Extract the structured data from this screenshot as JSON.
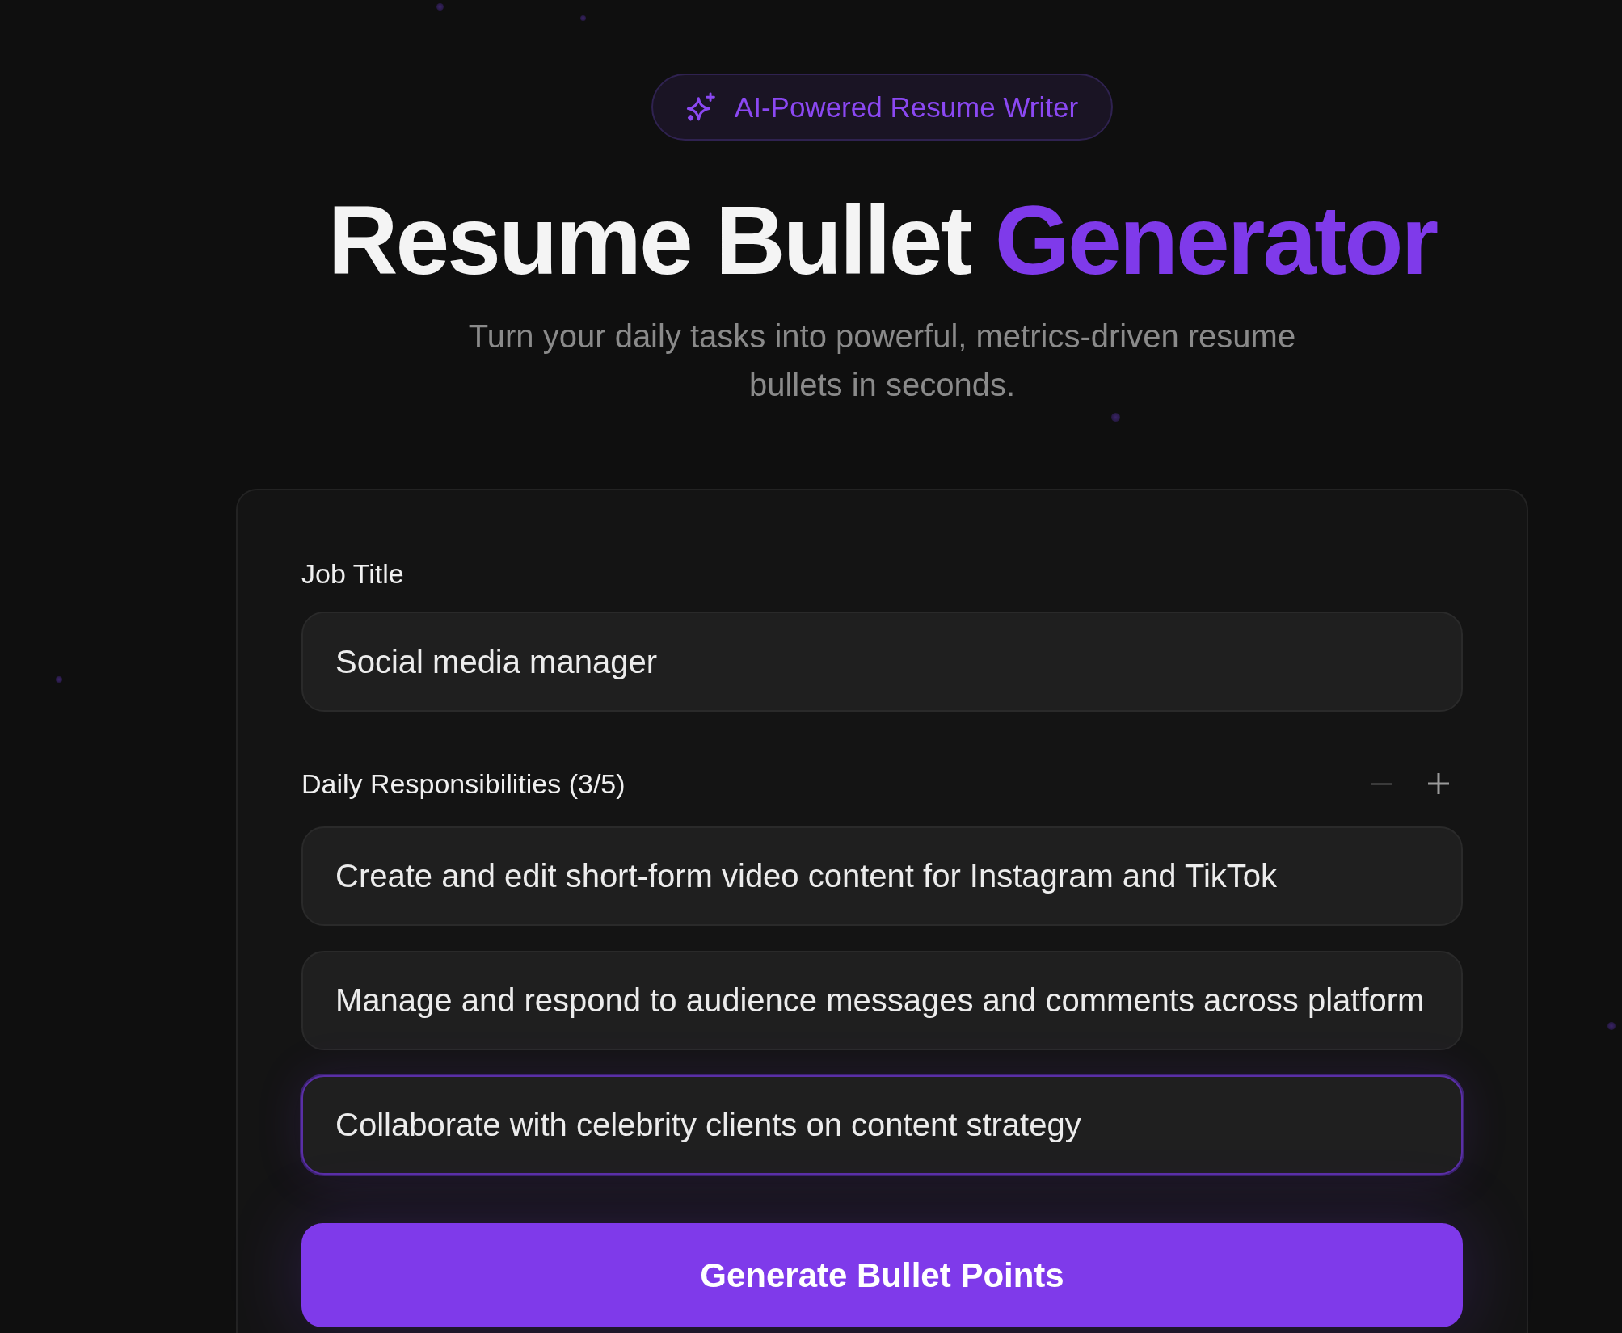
{
  "badge": {
    "label": "AI-Powered Resume Writer"
  },
  "title": {
    "parts": [
      {
        "text": "Resume Bullet",
        "accent": false
      },
      {
        "text": "Generator",
        "accent": true
      }
    ]
  },
  "subtitle": "Turn your daily tasks into powerful, metrics-driven resume bullets in seconds.",
  "form": {
    "job_title": {
      "label": "Job Title",
      "value": "Social media manager"
    },
    "responsibilities": {
      "label": "Daily Responsibilities (3/5)",
      "buttons": [
        {
          "kind": "remove",
          "disabled": true
        },
        {
          "kind": "add",
          "disabled": false
        }
      ],
      "items": [
        {
          "value": "Create and edit short-form video content for Instagram and TikTok",
          "focused": false
        },
        {
          "value": "Manage and respond to audience messages and comments across platform",
          "focused": false
        },
        {
          "value": "Collaborate with celebrity clients on content strategy",
          "focused": true
        }
      ]
    },
    "submit": {
      "label": "Generate Bullet Points"
    }
  }
}
